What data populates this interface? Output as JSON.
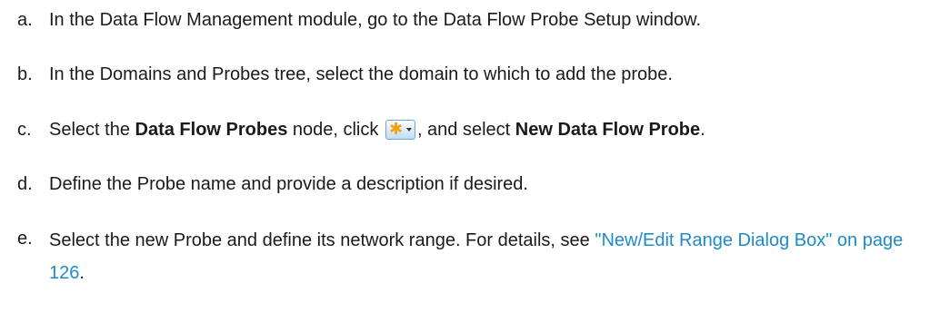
{
  "steps": [
    {
      "marker": "a.",
      "text": "In the Data Flow Management module, go to the Data Flow Probe Setup window."
    },
    {
      "marker": "b.",
      "text": "In the Domains and Probes tree, select the domain to which to add the probe."
    },
    {
      "marker": "c.",
      "part1": "Select the ",
      "bold1": "Data Flow Probes",
      "part2": " node, click ",
      "button_icon": "new-star-dropdown-icon",
      "part3": ", and select ",
      "bold2": "New Data Flow Probe",
      "part4": "."
    },
    {
      "marker": "d.",
      "text": "Define the Probe name and provide a description if desired."
    },
    {
      "marker": "e.",
      "text": "Select the new Probe and define its network range. For details, see ",
      "link": "\"New/Edit Range Dialog Box\" on page 126",
      "end": "."
    }
  ],
  "colors": {
    "text": "#1a1a1a",
    "link": "#1d8ac9",
    "icon_star": "#f2a30d"
  }
}
